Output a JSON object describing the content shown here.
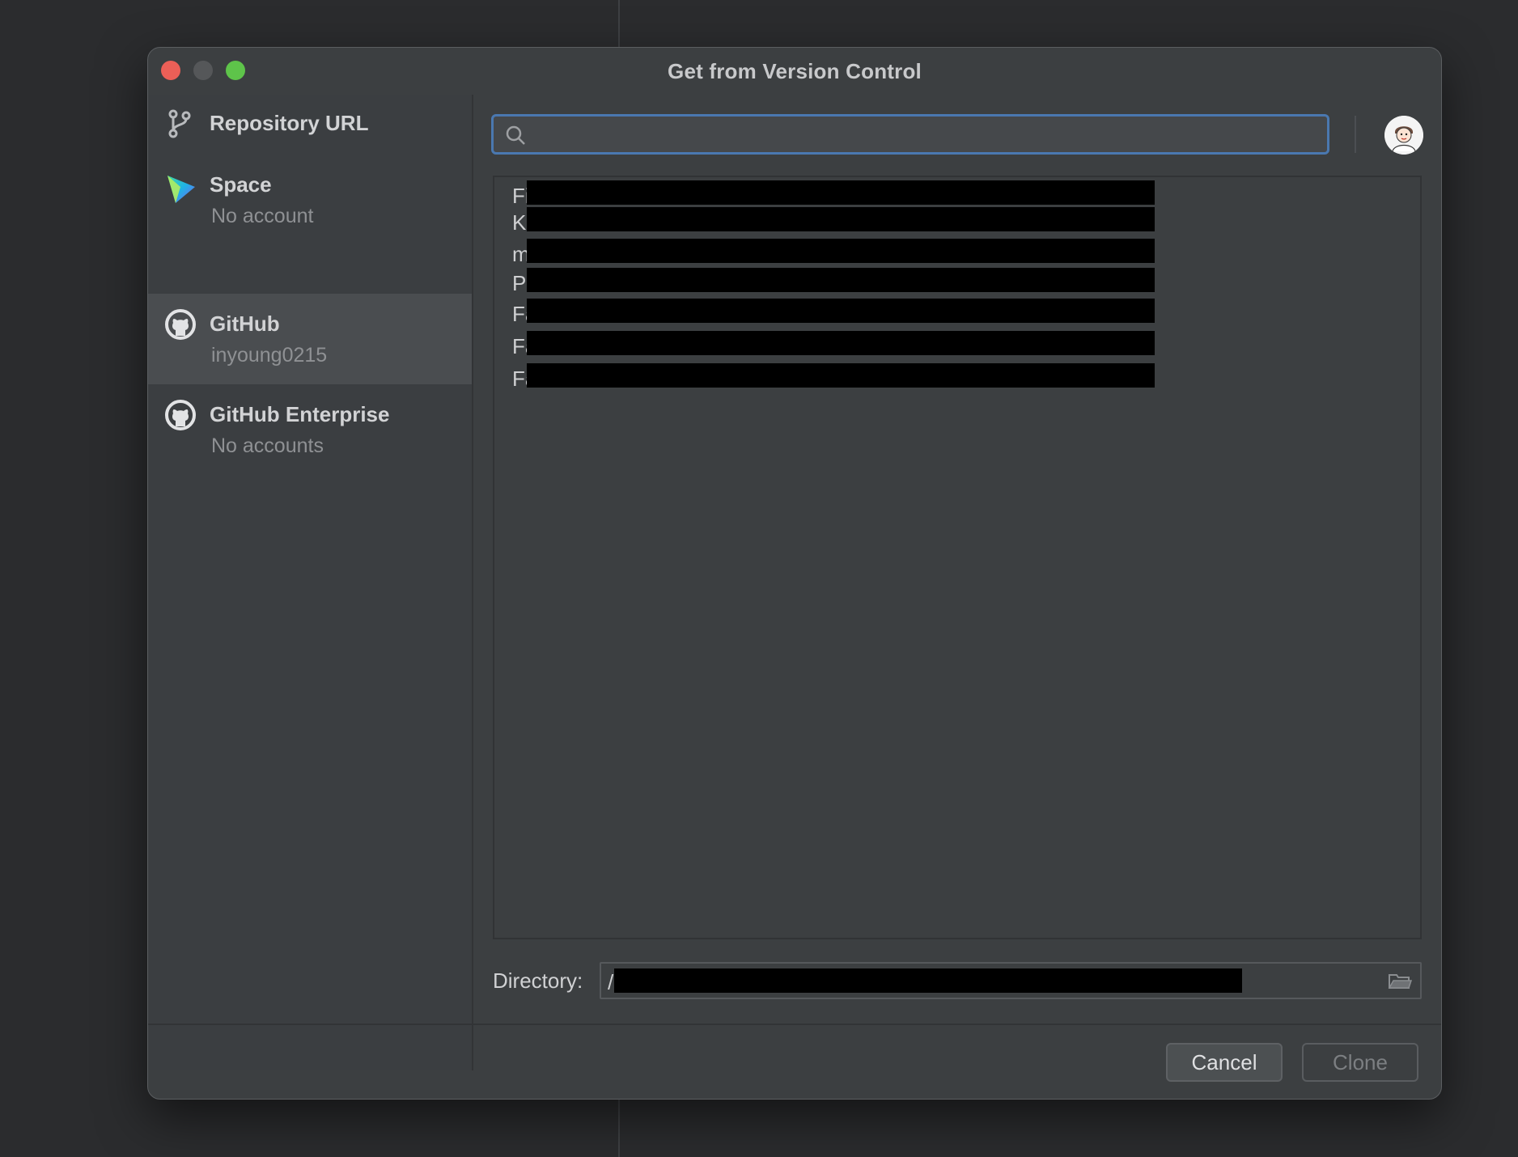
{
  "window": {
    "title": "Get from Version Control"
  },
  "sidebar": {
    "items": [
      {
        "name": "Repository URL",
        "sub": ""
      },
      {
        "name": "Space",
        "sub": "No account"
      },
      {
        "name": "GitHub",
        "sub": "inyoung0215"
      },
      {
        "name": "GitHub Enterprise",
        "sub": "No accounts"
      }
    ]
  },
  "search": {
    "value": "",
    "placeholder": ""
  },
  "repositories": [
    {
      "visible_prefix": "Fi",
      "redacted": true
    },
    {
      "visible_prefix": "K",
      "redacted": true
    },
    {
      "visible_prefix": "m",
      "redacted": true
    },
    {
      "visible_prefix": "P",
      "redacted": true
    },
    {
      "visible_prefix": "Fa",
      "redacted": true
    },
    {
      "visible_prefix": "Fa",
      "redacted": true
    },
    {
      "visible_prefix": "Fa",
      "redacted": true
    }
  ],
  "directory": {
    "label": "Directory:",
    "value_prefix": "/",
    "redacted": true
  },
  "buttons": {
    "cancel": "Cancel",
    "clone": "Clone"
  },
  "icons": {
    "repository": "git-branch-icon",
    "space": "jetbrains-space-icon",
    "github": "github-icon",
    "github_enterprise": "github-icon",
    "search": "search-icon",
    "directory": "folder-icon"
  },
  "colors": {
    "window_bg": "#3c3f41",
    "selected_item": "#4a4d50",
    "focus_border": "#4a78b0",
    "close": "#ec5f57",
    "maximize": "#5ec44a"
  }
}
